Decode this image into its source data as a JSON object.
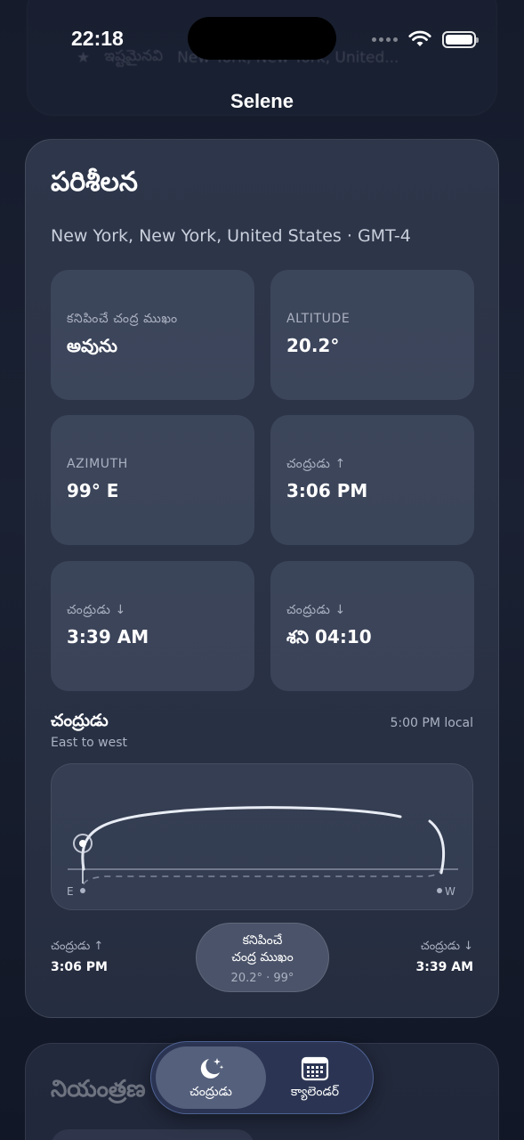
{
  "status_bar": {
    "time": "22:18"
  },
  "background_peek": {
    "fav_label": "ఇష్టమైనవి",
    "location": "New York, New York, United..."
  },
  "app": {
    "title": "Selene"
  },
  "observation": {
    "title": "పరిశీలన",
    "location": "New York, New York, United States · GMT-4",
    "tiles": [
      {
        "label": "కనిపించే చంద్ర ముఖం",
        "value": "అవును"
      },
      {
        "label": "ALTITUDE",
        "value": "20.2°"
      },
      {
        "label": "AZIMUTH",
        "value": "99° E"
      },
      {
        "label": "చంద్రుడు ↑",
        "value": "3:06 PM"
      },
      {
        "label": "చంద్రుడు ↓",
        "value": "3:39 AM"
      },
      {
        "label": "చంద్రుడు ↓",
        "value": "శని 04:10"
      }
    ]
  },
  "path_section": {
    "title": "చంద్రుడు",
    "subtitle": "East to west",
    "time_label": "5:00 PM local",
    "east_label": "E",
    "west_label": "W",
    "rise_label": "చంద్రుడు ↑",
    "rise_time": "3:06 PM",
    "set_label": "చంద్రుడు ↓",
    "set_time": "3:39 AM",
    "pill_line1": "కనిపించే",
    "pill_line2": "చంద్ర ముఖం",
    "pill_value": "20.2° · 99°"
  },
  "controls_peek": {
    "title": "నియంత్రణ"
  },
  "tab_bar": {
    "tabs": [
      {
        "label": "చంద్రుడు",
        "icon": "moon-stars-icon",
        "active": true
      },
      {
        "label": "క్యాలెండర్",
        "icon": "calendar-icon",
        "active": false
      }
    ]
  },
  "colors": {
    "accent_border": "#6e87c8",
    "background": "#151b2b",
    "card": "#363f54"
  }
}
